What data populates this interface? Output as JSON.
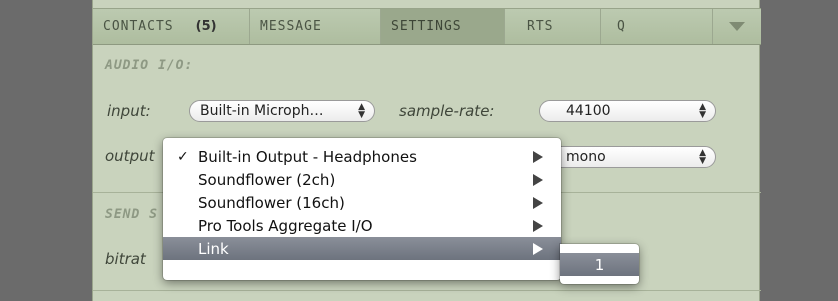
{
  "tabs": [
    {
      "label": "CONTACTS",
      "count": "(5)"
    },
    {
      "label": "MESSAGE"
    },
    {
      "label": "SETTINGS"
    },
    {
      "label": "RTS"
    },
    {
      "label": "Q"
    }
  ],
  "audio_io": {
    "title": "AUDIO I/O:",
    "input_label": "input:",
    "input_value": "Built-in Microph…",
    "sample_rate_label": "sample-rate:",
    "sample_rate_value": "44100",
    "output_label": "output",
    "channels_value": "mono"
  },
  "send": {
    "title": "SEND S",
    "bitrate_label": "bitrat"
  },
  "output_menu": {
    "items": [
      {
        "label": "Built-in Output - Headphones",
        "checked": true
      },
      {
        "label": "Soundflower (2ch)"
      },
      {
        "label": "Soundflower (16ch)"
      },
      {
        "label": "Pro Tools Aggregate I/O"
      },
      {
        "label": "Link",
        "selected": true
      }
    ],
    "check_mark": "✓"
  },
  "link_submenu": {
    "items": [
      {
        "label": "1"
      }
    ]
  },
  "colors": {
    "panel": "#c9d3bd",
    "tab_active": "#9aa88c",
    "menu_highlight": "#7a808b"
  }
}
